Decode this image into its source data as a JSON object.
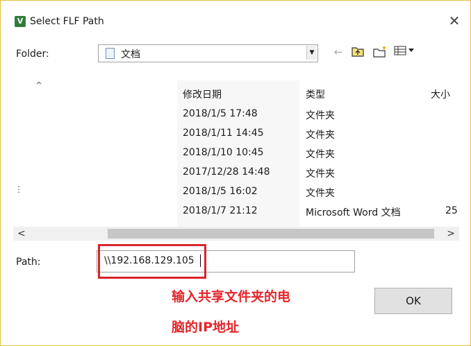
{
  "window": {
    "title": "Select FLF Path",
    "close_glyph": "✕",
    "app_icon": "flf-app-icon"
  },
  "folder": {
    "label": "Folder:",
    "value": "文档",
    "icon": "document-icon"
  },
  "toolbar": {
    "back": "←",
    "up": "up-folder-icon",
    "new": "new-folder-icon",
    "view": "view-menu-icon"
  },
  "list": {
    "columns": [
      "修改日期",
      "类型",
      "大小"
    ],
    "rows": [
      {
        "modified": "2018/1/5 17:48",
        "type": "文件夹",
        "size": ""
      },
      {
        "modified": "2018/1/11 14:45",
        "type": "文件夹",
        "size": ""
      },
      {
        "modified": "2018/1/10 10:45",
        "type": "文件夹",
        "size": ""
      },
      {
        "modified": "2017/12/28 14:48",
        "type": "文件夹",
        "size": ""
      },
      {
        "modified": "2018/1/5 16:02",
        "type": "文件夹",
        "size": ""
      },
      {
        "modified": "2018/1/7 21:12",
        "type": "Microsoft Word 文档",
        "size": "25"
      }
    ]
  },
  "scroll": {
    "left": "<",
    "right": ">"
  },
  "path": {
    "label": "Path:",
    "value": "\\\\192.168.129.105"
  },
  "annotation": {
    "line1": "输入共享文件夹的电",
    "line2": "脑的IP地址",
    "color": "#e5262a"
  },
  "ok_label": "OK"
}
